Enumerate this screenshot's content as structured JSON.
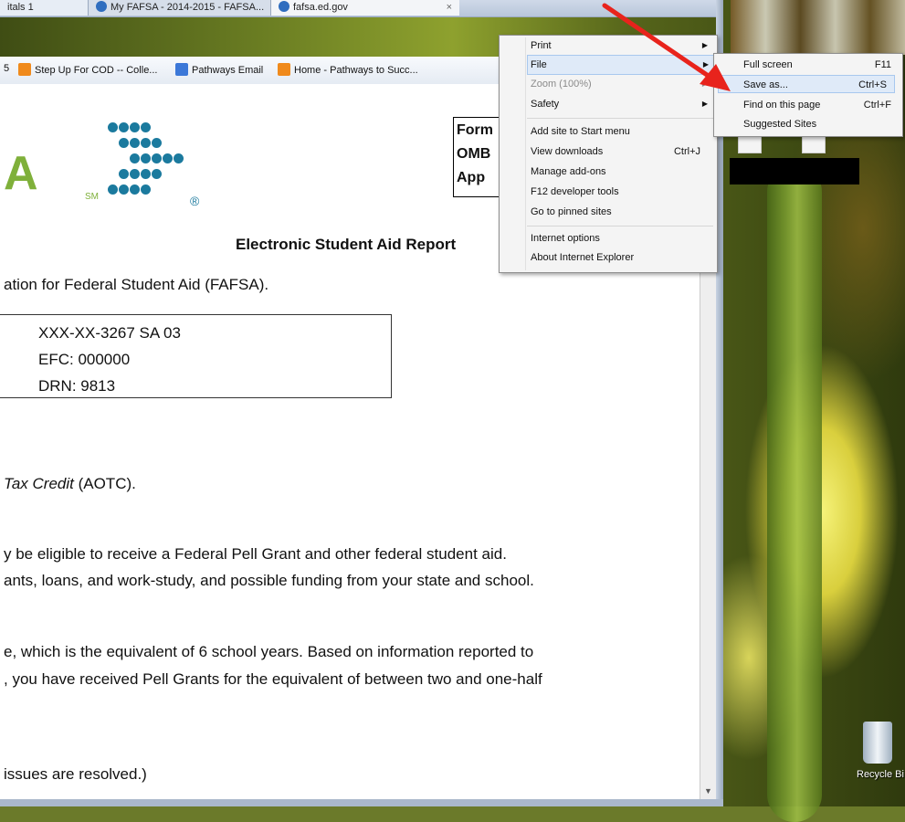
{
  "browser": {
    "tabs": [
      {
        "label": "itals 1"
      },
      {
        "label": "My FAFSA - 2014-2015 - FAFSA..."
      },
      {
        "label": "fafsa.ed.gov"
      }
    ],
    "favorites": [
      {
        "label": "5",
        "icon": "page-icon"
      },
      {
        "label": "Step Up For COD -- Colle...",
        "icon": "tile-icon"
      },
      {
        "label": "Pathways Email",
        "icon": "google-icon"
      },
      {
        "label": "Home - Pathways to Succ...",
        "icon": "tile-icon"
      }
    ]
  },
  "page": {
    "logo": {
      "letter": "A",
      "sm": "SM",
      "registered": "®"
    },
    "omb": [
      "Form",
      "OMB",
      "App"
    ],
    "heading": "Electronic Student Aid Report",
    "line1": "ation for Federal Student Aid (FAFSA).",
    "info_box": [
      "XXX-XX-3267 SA 03",
      "EFC:  000000",
      "DRN:  9813"
    ],
    "aotc_prefix": "Tax Credit",
    "aotc_suffix": " (AOTC).",
    "para1_a": "y be eligible to receive a Federal Pell Grant and other federal student aid.",
    "para1_b": "ants, loans, and work-study, and possible funding from your state and school.",
    "para2_a": "e, which is the equivalent of 6 school years.  Based on information reported to",
    "para2_b": ", you have received Pell Grants for the equivalent of between two and one-half",
    "para3": "issues are resolved.)"
  },
  "menu": {
    "items": [
      {
        "label": "Print",
        "submenu": true
      },
      {
        "label": "File",
        "submenu": true,
        "highlight": true
      },
      {
        "label": "Zoom (100%)",
        "submenu": true,
        "disabled": true
      },
      {
        "label": "Safety",
        "submenu": true
      },
      {
        "label": "Add site to Start menu"
      },
      {
        "label": "View downloads",
        "shortcut": "Ctrl+J"
      },
      {
        "label": "Manage add-ons"
      },
      {
        "label": "F12 developer tools"
      },
      {
        "label": "Go to pinned sites"
      },
      {
        "label": "Internet options"
      },
      {
        "label": "About Internet Explorer"
      }
    ],
    "file_submenu": [
      {
        "label": "Full screen",
        "shortcut": "F11"
      },
      {
        "label": "Save as...",
        "shortcut": "Ctrl+S",
        "highlight": true
      },
      {
        "label": "Find on this page",
        "shortcut": "Ctrl+F"
      },
      {
        "label": "Suggested Sites"
      }
    ]
  },
  "desktop": {
    "recycle_bin": "Recycle Bi"
  },
  "colors": {
    "accent_arrow": "#e8231c",
    "logo_green": "#7fb03a",
    "logo_blue": "#1b7a9e",
    "menu_highlight": "#dfeaf8"
  }
}
